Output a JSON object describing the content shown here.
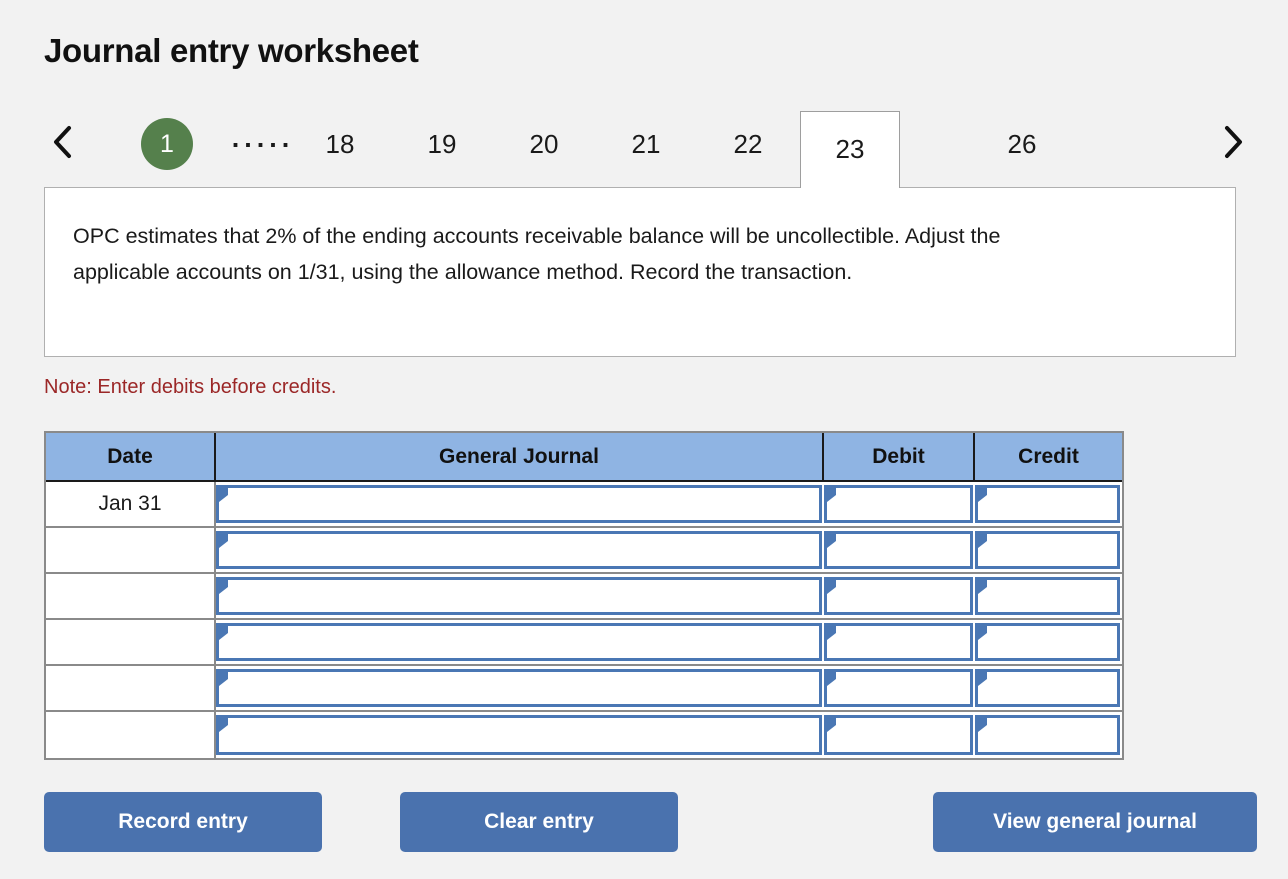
{
  "page": {
    "title": "Journal entry worksheet",
    "background_color": "#f2f2f2"
  },
  "tabs": {
    "prev_label": "chevron-left",
    "next_label": "chevron-right",
    "ellipsis": ".....",
    "items": [
      {
        "label": "1",
        "state": "completed"
      },
      {
        "label": "18",
        "state": "normal"
      },
      {
        "label": "19",
        "state": "normal"
      },
      {
        "label": "20",
        "state": "normal"
      },
      {
        "label": "21",
        "state": "normal"
      },
      {
        "label": "22",
        "state": "normal"
      },
      {
        "label": "23",
        "state": "active"
      },
      {
        "label": "26",
        "state": "normal"
      }
    ],
    "active_label": "23",
    "completed_color": "#55804c"
  },
  "description": {
    "text": "OPC estimates that 2% of the ending accounts receivable balance will be uncollectible. Adjust the applicable accounts on 1/31, using the allowance method. Record the transaction."
  },
  "note": {
    "text": "Note: Enter debits before credits.",
    "color": "#9b2727"
  },
  "journal": {
    "headers": {
      "date": "Date",
      "general_journal": "General Journal",
      "debit": "Debit",
      "credit": "Credit"
    },
    "header_bg": "#8fb4e3",
    "input_border_color": "#4a77b4",
    "rows": [
      {
        "date": "Jan 31",
        "account": "",
        "debit": "",
        "credit": ""
      },
      {
        "date": "",
        "account": "",
        "debit": "",
        "credit": ""
      },
      {
        "date": "",
        "account": "",
        "debit": "",
        "credit": ""
      },
      {
        "date": "",
        "account": "",
        "debit": "",
        "credit": ""
      },
      {
        "date": "",
        "account": "",
        "debit": "",
        "credit": ""
      },
      {
        "date": "",
        "account": "",
        "debit": "",
        "credit": ""
      }
    ]
  },
  "buttons": {
    "record": "Record entry",
    "clear": "Clear entry",
    "view": "View general journal",
    "color": "#4a72ae"
  }
}
